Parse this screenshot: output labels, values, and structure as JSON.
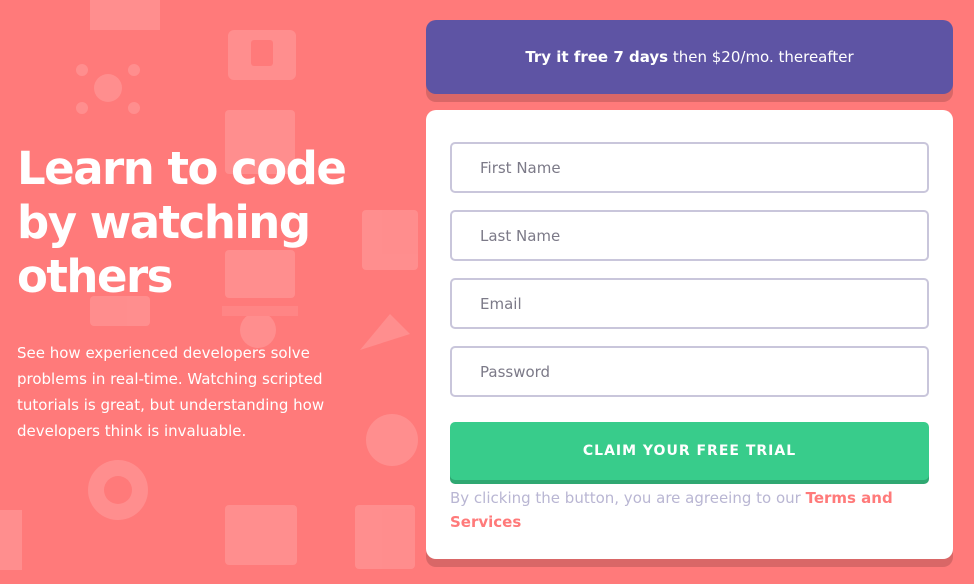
{
  "hero": {
    "title": "Learn to code\nby watching\nothers",
    "description": "See how experienced developers solve problems in real-time. Watching scripted tutorials is great, but understanding how developers think is invaluable."
  },
  "promo": {
    "bold": "Try it free 7 days",
    "rest": " then $20/mo. thereafter"
  },
  "form": {
    "first_name_placeholder": "First Name",
    "last_name_placeholder": "Last Name",
    "email_placeholder": "Email",
    "password_placeholder": "Password",
    "submit_label": "CLAIM YOUR FREE TRIAL",
    "terms_prefix": "By clicking the button, you are agreeing to our ",
    "terms_link": "Terms and Services"
  },
  "colors": {
    "background": "#ff7a7a",
    "promo": "#5e54a4",
    "button": "#38cc8b",
    "card": "#ffffff"
  }
}
